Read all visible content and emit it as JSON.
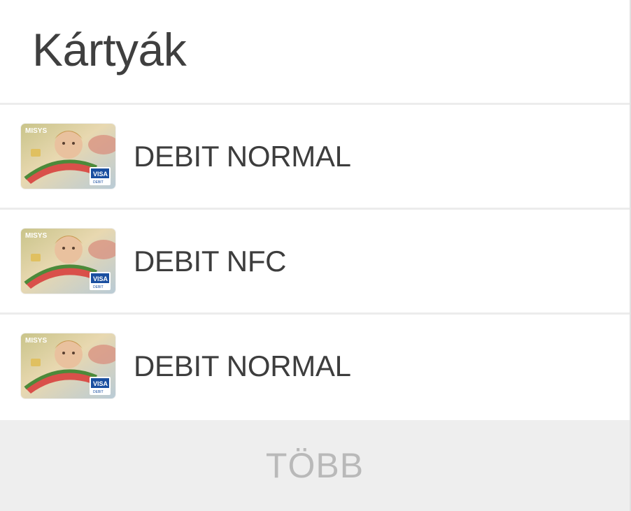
{
  "header": {
    "title": "Kártyák"
  },
  "cards": [
    {
      "name": "DEBIT NORMAL",
      "card_icon": "card-thumbnail-icon",
      "brand": "MISYS",
      "network": "VISA",
      "network_sub": "DEBIT"
    },
    {
      "name": "DEBIT NFC",
      "card_icon": "card-thumbnail-icon",
      "brand": "MISYS",
      "network": "VISA",
      "network_sub": "DEBIT"
    },
    {
      "name": "DEBIT NORMAL",
      "card_icon": "card-thumbnail-icon",
      "brand": "MISYS",
      "network": "VISA",
      "network_sub": "DEBIT"
    }
  ],
  "footer": {
    "more_label": "TÖBB"
  },
  "colors": {
    "title_text": "#3f3f3f",
    "row_text": "#3d3d3d",
    "divider": "#ececec",
    "more_background": "#eeeeee",
    "more_text": "#b9b9b9",
    "visa_blue": "#1a4fa0"
  }
}
